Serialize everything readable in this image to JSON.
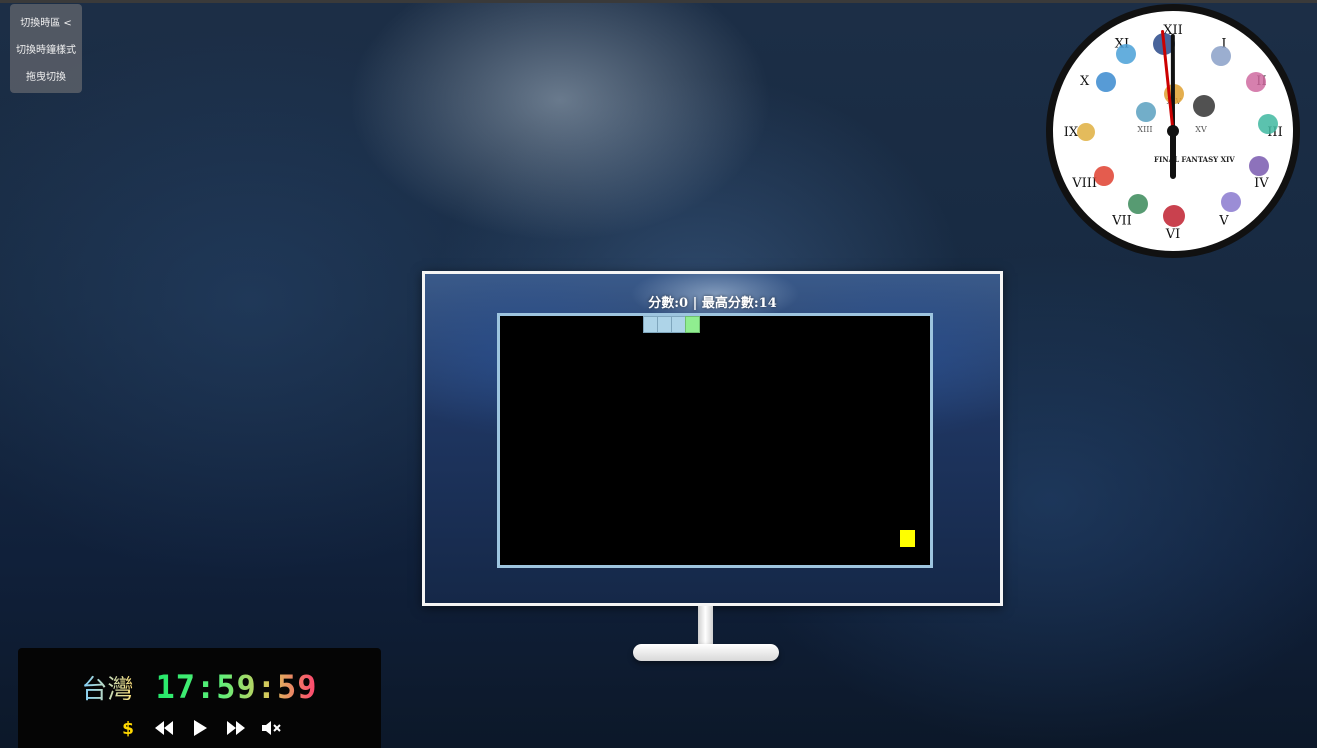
{
  "menu": {
    "items": [
      {
        "label": "切換時區 <"
      },
      {
        "label": "切換時鐘樣式"
      },
      {
        "label": "拖曳切換"
      }
    ]
  },
  "clock": {
    "numerals": [
      "XII",
      "I",
      "II",
      "III",
      "IV",
      "V",
      "VI",
      "VII",
      "VIII",
      "IX",
      "X",
      "XI"
    ],
    "inner_numerals": [
      "XIV",
      "XIII",
      "XV"
    ],
    "logo_text": "FINAL FANTASY XIV",
    "hour": 5,
    "minute": 59,
    "second": 59,
    "colors": {
      "face": "#ffffff",
      "rim": "#111111",
      "second_hand": "#cc0000",
      "hand": "#111111"
    }
  },
  "game": {
    "score_text": "分數:0 | 最高分數:14",
    "snake_length": 4,
    "colors": {
      "snake_body": "#aed4e8",
      "snake_head": "#90ee90",
      "food": "#ffff00",
      "board": "#000000",
      "board_border": "#9ec5df"
    }
  },
  "clock_panel": {
    "region": "台灣",
    "time": "17:59:59",
    "controls": [
      {
        "icon": "dollar-coin-icon",
        "glyph": "$"
      },
      {
        "icon": "rewind-icon",
        "glyph": "◀◀"
      },
      {
        "icon": "play-icon",
        "glyph": "▶"
      },
      {
        "icon": "fast-forward-icon",
        "glyph": "▶▶"
      },
      {
        "icon": "mute-icon",
        "glyph": "🔇"
      }
    ]
  }
}
